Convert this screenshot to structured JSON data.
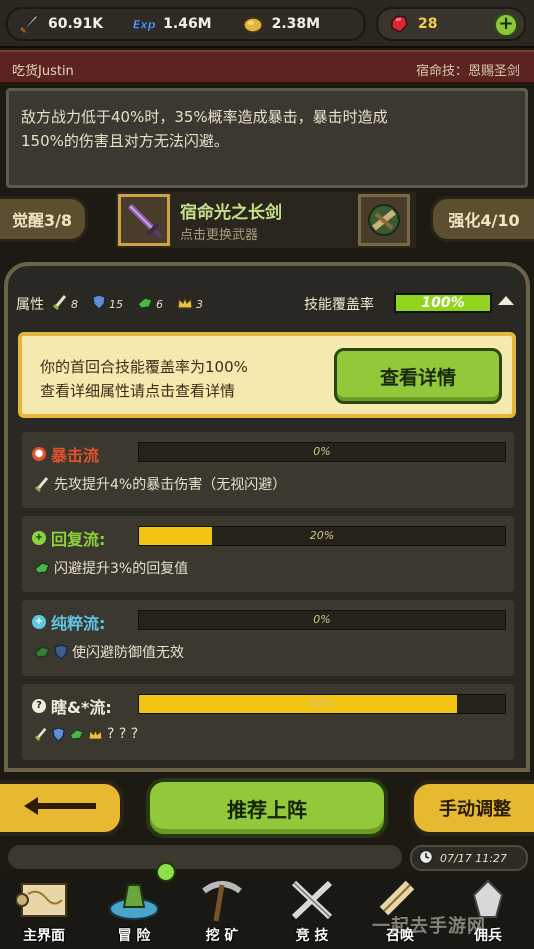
{
  "resources": {
    "attack": "60.91K",
    "exp": "1.46M",
    "gold": "2.38M",
    "gems": "28"
  },
  "profile": {
    "name": "吃货Justin",
    "skill": "宿命技：恩赐圣剑"
  },
  "description": {
    "line1": "敌方战力低于40%时，35%概率造成暴击，暴击时造成",
    "line2": "150%的伤害且对方无法闪避。"
  },
  "weapon": {
    "awaken": "觉醒3/8",
    "name": "宿命光之长剑",
    "hint": "点击更换武器",
    "enhance": "强化4/10"
  },
  "attributes": {
    "label": "属性",
    "values": [
      "8",
      "15",
      "6",
      "3"
    ],
    "coverage_label": "技能覆盖率",
    "coverage_text": "100%",
    "coverage_fraction": 1.0
  },
  "banner": {
    "line1": "你的首回合技能覆盖率为100%",
    "line2": "查看详细属性请点击查看详情",
    "button": "查看详情"
  },
  "flows": [
    {
      "name": "暴击流",
      "color": "#e0522e",
      "pct_text": "0%",
      "fraction": 0.0,
      "desc": "先攻提升4%的暴击伤害（无视闪避）"
    },
    {
      "name": "回复流:",
      "color": "#8bd33a",
      "pct_text": "20%",
      "fraction": 0.2,
      "desc": "闪避提升3%的回复值"
    },
    {
      "name": "纯粹流:",
      "color": "#5fc6e6",
      "pct_text": "0%",
      "fraction": 0.0,
      "desc": "使闪避防御值无效"
    },
    {
      "name": "瞎&*流:",
      "color": "#f0ead8",
      "pct_text": "87%",
      "fraction": 0.87,
      "desc": "? ? ?"
    }
  ],
  "actions": {
    "recommend": "推荐上阵",
    "manual": "手动调整"
  },
  "clock": "07/17 11:27",
  "nav": [
    "主界面",
    "冒 险",
    "挖 矿",
    "竞 技",
    "召唤",
    "佣兵"
  ],
  "watermark": "一起去手游网"
}
